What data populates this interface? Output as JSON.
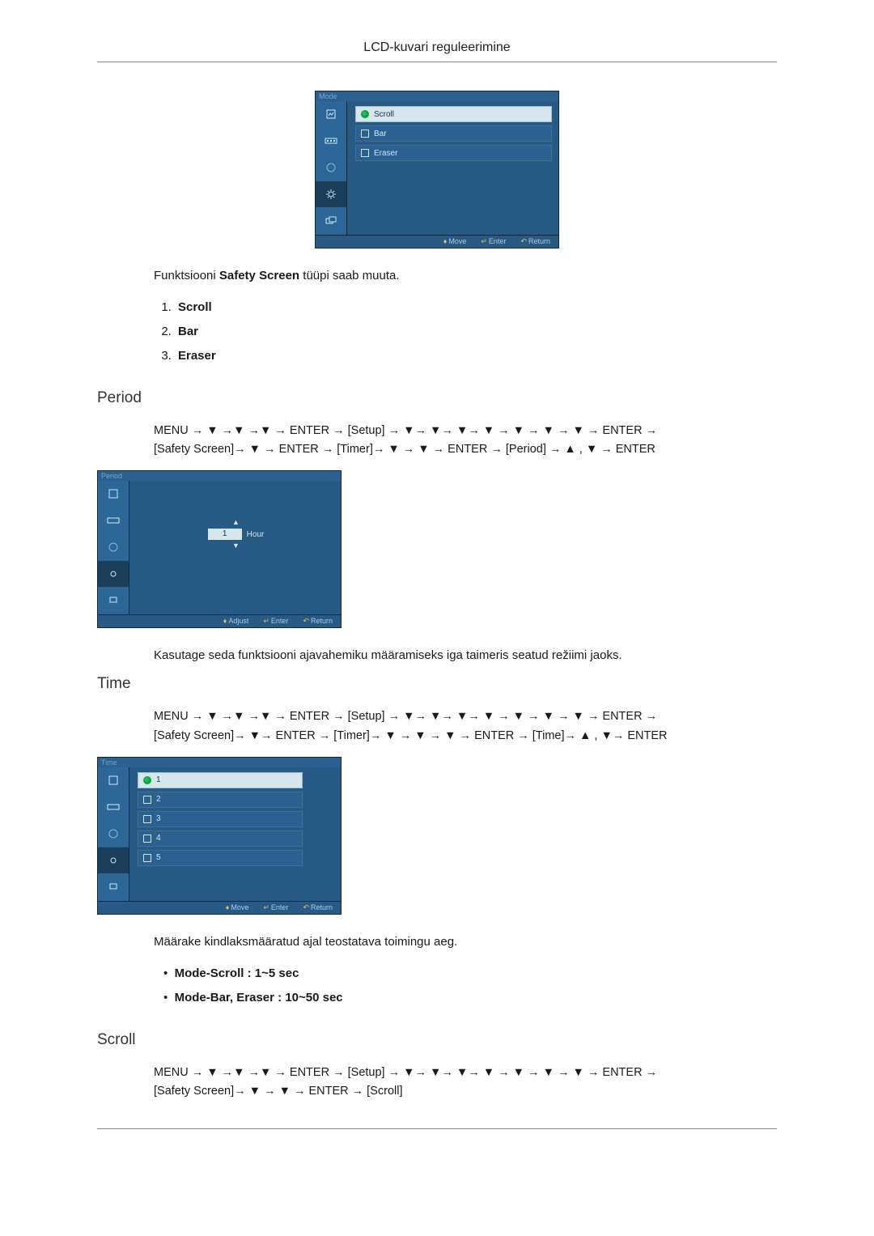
{
  "header": {
    "title": "LCD-kuvari reguleerimine"
  },
  "osd_mode": {
    "title": "Mode",
    "items": [
      "Scroll",
      "Bar",
      "Eraser"
    ],
    "selected_index": 0,
    "footer": {
      "move": "Move",
      "enter": "Enter",
      "return": "Return"
    }
  },
  "mode_block": {
    "lead_pre": "Funktsiooni ",
    "lead_bold": "Safety Screen",
    "lead_post": " tüüpi saab muuta.",
    "options": [
      "Scroll",
      "Bar",
      "Eraser"
    ]
  },
  "period": {
    "heading": "Period",
    "path_line1": "MENU → ▼ →▼ →▼ → ENTER → [Setup] → ▼→ ▼→ ▼→ ▼ → ▼ → ▼ → ▼ → ENTER →",
    "path_line2": "[Safety Screen]→ ▼ → ENTER → [Timer]→ ▼ → ▼ → ENTER → [Period] → ▲ , ▼ → ENTER",
    "osd": {
      "title": "Period",
      "value": "1",
      "unit": "Hour",
      "footer": {
        "adjust": "Adjust",
        "enter": "Enter",
        "return": "Return"
      }
    },
    "desc": "Kasutage seda funktsiooni ajavahemiku määramiseks iga taimeris seatud režiimi jaoks."
  },
  "time": {
    "heading": "Time",
    "path_line1": "MENU → ▼ →▼ →▼ → ENTER → [Setup] → ▼→ ▼→ ▼→ ▼ → ▼ → ▼ → ▼ → ENTER →",
    "path_line2": "[Safety Screen]→ ▼→ ENTER → [Timer]→ ▼ → ▼ → ▼ → ENTER → [Time]→ ▲ , ▼→ ENTER",
    "osd": {
      "title": "Time",
      "items": [
        "1",
        "2",
        "3",
        "4",
        "5"
      ],
      "selected_index": 0,
      "footer": {
        "move": "Move",
        "enter": "Enter",
        "return": "Return"
      }
    },
    "desc": "Määrake kindlaksmääratud ajal teostatava toimingu aeg.",
    "bullets": [
      {
        "label": "Mode-Scroll",
        "value": " : 1~5 sec"
      },
      {
        "label": "Mode-Bar, Eraser",
        "value": " : 10~50 sec"
      }
    ]
  },
  "scroll": {
    "heading": "Scroll",
    "path_line1": "MENU → ▼ →▼ →▼ → ENTER → [Setup] → ▼→ ▼→ ▼→ ▼ → ▼ → ▼ → ▼ → ENTER →",
    "path_line2": "[Safety Screen]→ ▼ → ▼ → ENTER → [Scroll]"
  }
}
